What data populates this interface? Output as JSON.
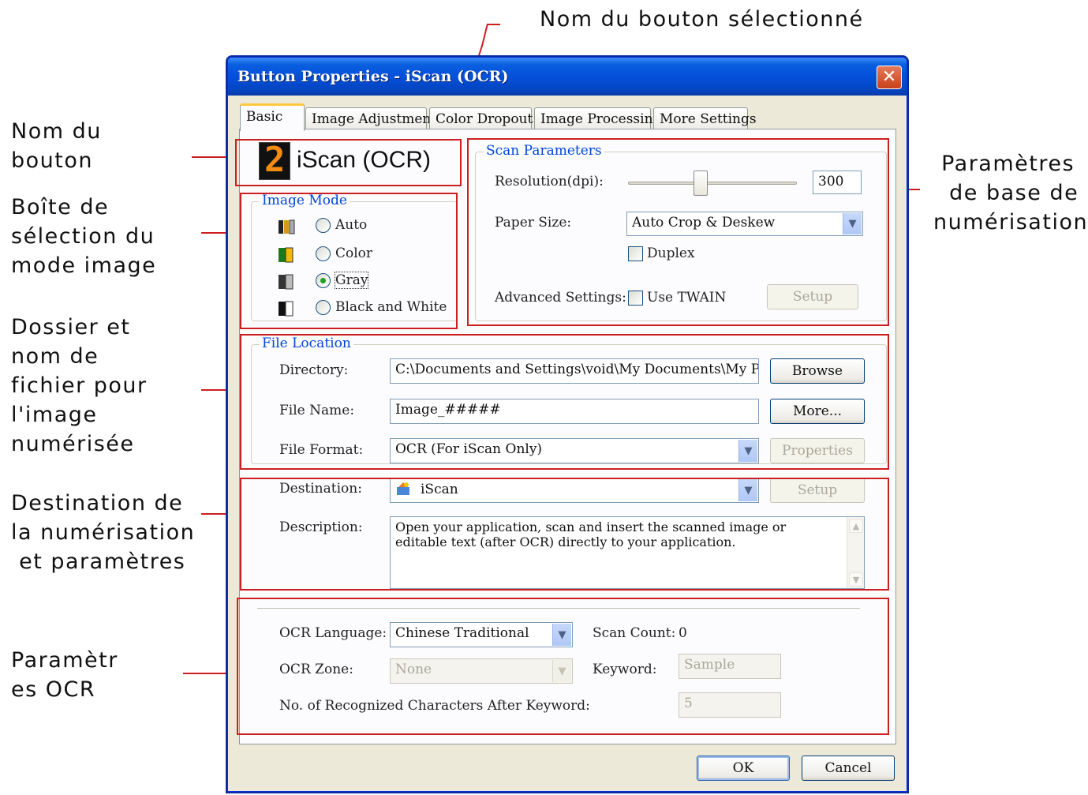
{
  "annotations": {
    "selected_button_name": "Nom du bouton sélectionné",
    "button_name": [
      "Nom du",
      "bouton"
    ],
    "image_mode_box": [
      "Boîte de",
      "sélection du",
      "mode image"
    ],
    "file_location": [
      "Dossier et",
      "nom de",
      "fichier pour",
      "l'image",
      "numérisée"
    ],
    "destination": [
      "Destination de",
      "la numérisation",
      " et paramètres"
    ],
    "ocr_params": [
      "Paramètr",
      "es OCR"
    ],
    "scan_params": [
      " Paramètres",
      "  de base de",
      "numérisation"
    ]
  },
  "dialog": {
    "title": "Button Properties - iScan (OCR)",
    "close_glyph": "✕",
    "tabs": [
      "Basic",
      "Image Adjustment",
      "Color Dropout",
      "Image Processing",
      "More Settings"
    ],
    "button_number": "2",
    "button_name": "iScan (OCR)",
    "image_mode": {
      "legend": "Image Mode",
      "options": [
        "Auto",
        "Color",
        "Gray",
        "Black and White"
      ],
      "selected": "Gray"
    },
    "scan_parameters": {
      "legend": "Scan Parameters",
      "resolution_label": "Resolution(dpi):",
      "resolution_value": "300",
      "paper_size_label": "Paper Size:",
      "paper_size_value": "Auto Crop & Deskew",
      "duplex_label": "Duplex",
      "advanced_label": "Advanced Settings:",
      "use_twain_label": "Use TWAIN",
      "setup_label": "Setup"
    },
    "file_location": {
      "legend": "File Location",
      "directory_label": "Directory:",
      "directory_value": "C:\\Documents and Settings\\void\\My Documents\\My Pictures",
      "browse_label": "Browse",
      "file_name_label": "File Name:",
      "file_name_value": "Image_#####",
      "more_label": "More...",
      "file_format_label": "File Format:",
      "file_format_value": "OCR (For iScan Only)",
      "properties_label": "Properties"
    },
    "destination": {
      "destination_label": "Destination:",
      "destination_value": "iScan",
      "setup_label": "Setup",
      "description_label": "Description:",
      "description_value": "Open your application, scan and insert the scanned image or editable text (after OCR) directly to your application."
    },
    "ocr": {
      "language_label": "OCR Language:",
      "language_value": "Chinese Traditional",
      "scan_count_label": "Scan Count:",
      "scan_count_value": "0",
      "zone_label": "OCR Zone:",
      "zone_value": "None",
      "keyword_label": "Keyword:",
      "keyword_value": "Sample",
      "recognized_label": "No. of Recognized Characters After Keyword:",
      "recognized_value": "5"
    },
    "ok_label": "OK",
    "cancel_label": "Cancel"
  },
  "colors": {
    "annotation_red": "#cc1f1f",
    "titlebar_blue": "#0550d9",
    "legend_blue": "#0046d5",
    "dialog_bg": "#ece9d8"
  }
}
